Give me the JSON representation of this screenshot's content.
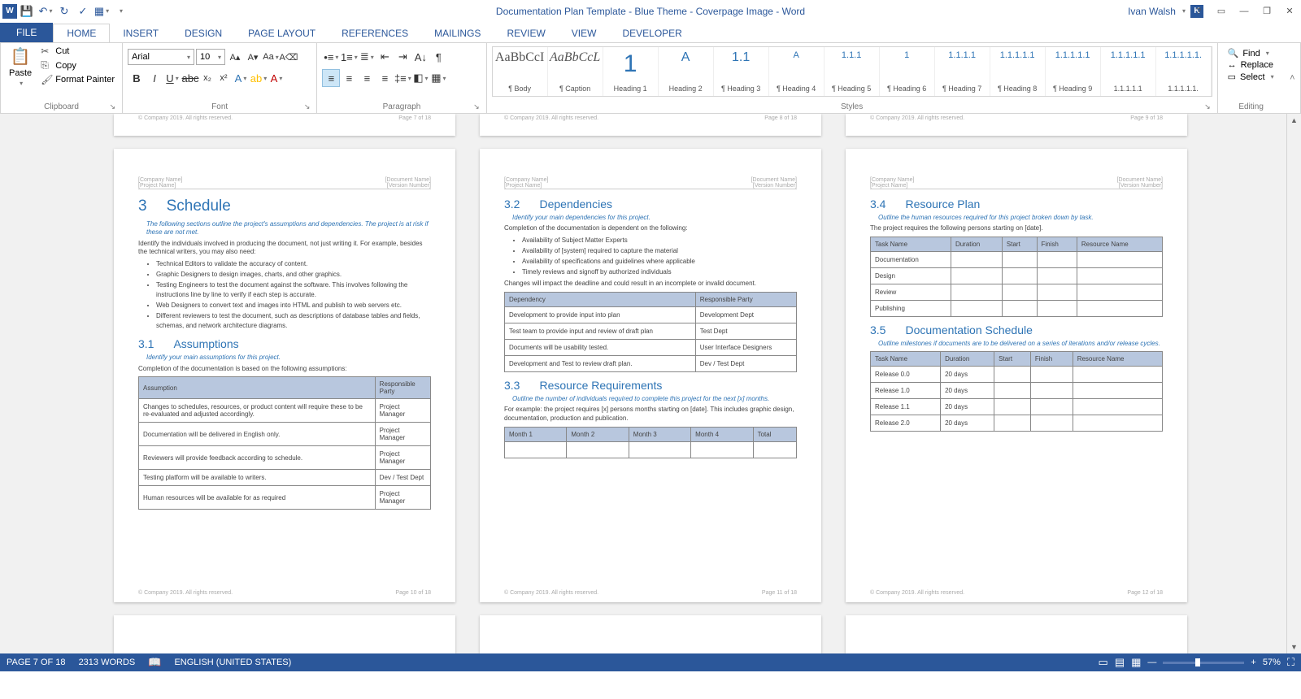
{
  "title": "Documentation Plan Template - Blue Theme - Coverpage Image - Word",
  "user": {
    "name": "Ivan Walsh",
    "initial": "K"
  },
  "tabs": [
    "FILE",
    "HOME",
    "INSERT",
    "DESIGN",
    "PAGE LAYOUT",
    "REFERENCES",
    "MAILINGS",
    "REVIEW",
    "VIEW",
    "DEVELOPER"
  ],
  "clipboard": {
    "paste": "Paste",
    "cut": "Cut",
    "copy": "Copy",
    "format_painter": "Format Painter",
    "label": "Clipboard"
  },
  "font": {
    "name": "Arial",
    "size": "10",
    "label": "Font"
  },
  "paragraph": {
    "label": "Paragraph"
  },
  "styles": {
    "label": "Styles",
    "items": [
      {
        "preview": "AaBbCcI",
        "name": "¶ Body",
        "cls": ""
      },
      {
        "preview": "AaBbCcL",
        "name": "¶ Caption",
        "cls": "italic"
      },
      {
        "preview": "1",
        "name": "Heading 1",
        "cls": "blue big"
      },
      {
        "preview": "A",
        "name": "Heading 2",
        "cls": "blue"
      },
      {
        "preview": "1.1",
        "name": "¶ Heading 3",
        "cls": "blue"
      },
      {
        "preview": "A",
        "name": "¶ Heading 4",
        "cls": "blue sm"
      },
      {
        "preview": "1.1.1",
        "name": "¶ Heading 5",
        "cls": "blue sm"
      },
      {
        "preview": "1",
        "name": "¶ Heading 6",
        "cls": "blue sm"
      },
      {
        "preview": "1.1.1.1",
        "name": "¶ Heading 7",
        "cls": "blue sm"
      },
      {
        "preview": "1.1.1.1.1",
        "name": "¶ Heading 8",
        "cls": "blue sm"
      },
      {
        "preview": "1.1.1.1.1",
        "name": "¶ Heading 9",
        "cls": "blue sm"
      },
      {
        "preview": "1.1.1.1.1",
        "name": "1.1.1.1.1",
        "cls": "blue sm"
      },
      {
        "preview": "1.1.1.1.1.",
        "name": "1.1.1.1.1.",
        "cls": "blue sm"
      }
    ]
  },
  "editing": {
    "find": "Find",
    "replace": "Replace",
    "select": "Select",
    "label": "Editing"
  },
  "doc": {
    "hdr_l1": "[Company Name]",
    "hdr_l2": "[Project Name]",
    "hdr_r1": "[Document Name]",
    "hdr_r2": "[Version Number]",
    "foot_l": "© Company 2019. All rights reserved.",
    "p7": "Page 7 of 18",
    "p8": "Page 8 of 18",
    "p9": "Page 9 of 18",
    "p10": "Page 10 of 18",
    "p11": "Page 11 of 18",
    "p12": "Page 12 of 18",
    "s3": {
      "n": "3",
      "t": "Schedule",
      "inst": "The following sections outline the project's assumptions and dependencies. The project is at risk if these are not met.",
      "p1": "Identify the individuals involved in producing the document, not just writing it. For example, besides the technical writers, you may also need:",
      "li": [
        "Technical Editors to validate the accuracy of content.",
        "Graphic Designers to design images, charts, and other graphics.",
        "Testing Engineers to test the document against the software. This involves following the instructions line by line to verify if each step is accurate.",
        "Web Designers to convert text and images into HTML and publish to web servers etc.",
        "Different reviewers to test the document, such as descriptions of database tables and fields, schemas, and network architecture diagrams."
      ]
    },
    "s31": {
      "n": "3.1",
      "t": "Assumptions",
      "inst": "Identify your main assumptions for this project.",
      "p": "Completion of the documentation is based on the following assumptions:",
      "th": [
        "Assumption",
        "Responsible Party"
      ],
      "rows": [
        [
          "Changes to schedules, resources, or product content will require these to be re-evaluated and adjusted accordingly.",
          "Project Manager"
        ],
        [
          "Documentation will be delivered in English only.",
          "Project Manager"
        ],
        [
          "Reviewers will provide feedback according to schedule.",
          "Project Manager"
        ],
        [
          "Testing platform will be available to writers.",
          "Dev / Test Dept"
        ],
        [
          "Human resources will be available for as required",
          "Project Manager"
        ]
      ]
    },
    "s32": {
      "n": "3.2",
      "t": "Dependencies",
      "inst": "Identify your main dependencies for this project.",
      "p": "Completion of the documentation is dependent on the following:",
      "li": [
        "Availability of Subject Matter Experts",
        "Availability of [system] required to capture the material",
        "Availability of specifications and guidelines where applicable",
        "Timely reviews and signoff by authorized individuals"
      ],
      "p2": "Changes will impact the deadline and could result in an incomplete or invalid document.",
      "th": [
        "Dependency",
        "Responsible Party"
      ],
      "rows": [
        [
          "Development to provide input into plan",
          "Development Dept"
        ],
        [
          "Test team to provide input and review of draft plan",
          "Test Dept"
        ],
        [
          "Documents will be usability tested.",
          "User Interface Designers"
        ],
        [
          "Development and Test to review draft plan.",
          "Dev / Test Dept"
        ]
      ]
    },
    "s33": {
      "n": "3.3",
      "t": "Resource Requirements",
      "inst": "Outline the number of individuals required to complete this project for the next [x] months.",
      "p": "For example: the project requires [x] persons months starting on [date]. This includes graphic design, documentation, production and publication.",
      "th": [
        "Month 1",
        "Month 2",
        "Month 3",
        "Month 4",
        "Total"
      ]
    },
    "s34": {
      "n": "3.4",
      "t": "Resource Plan",
      "inst": "Outline the human resources required for this project broken down by task.",
      "p": "The project requires the following persons starting on [date].",
      "th": [
        "Task Name",
        "Duration",
        "Start",
        "Finish",
        "Resource Name"
      ],
      "rows": [
        [
          "Documentation",
          "",
          "",
          "",
          ""
        ],
        [
          "Design",
          "",
          "",
          "",
          ""
        ],
        [
          "Review",
          "",
          "",
          "",
          ""
        ],
        [
          "Publishing",
          "",
          "",
          "",
          ""
        ]
      ]
    },
    "s35": {
      "n": "3.5",
      "t": "Documentation Schedule",
      "inst": "Outline milestones if documents are to be delivered on a series of iterations and/or release cycles.",
      "th": [
        "Task Name",
        "Duration",
        "Start",
        "Finish",
        "Resource Name"
      ],
      "rows": [
        [
          "Release 0.0",
          "20 days",
          "",
          "",
          ""
        ],
        [
          "Release 1.0",
          "20 days",
          "",
          "",
          ""
        ],
        [
          "Release 1.1",
          "20 days",
          "",
          "",
          ""
        ],
        [
          "Release 2.0",
          "20 days",
          "",
          "",
          ""
        ]
      ]
    }
  },
  "status": {
    "page": "PAGE 7 OF 18",
    "words": "2313 WORDS",
    "lang": "ENGLISH (UNITED STATES)",
    "zoom": "57%"
  }
}
